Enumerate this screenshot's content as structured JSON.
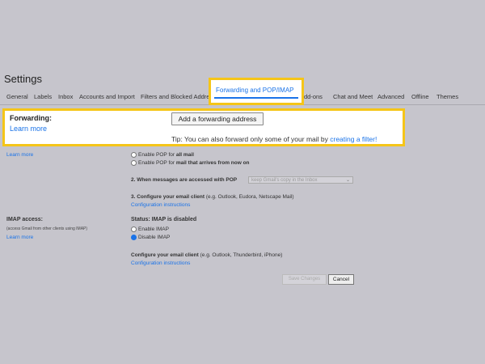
{
  "page_title": "Settings",
  "tabs": [
    {
      "label": "General"
    },
    {
      "label": "Labels"
    },
    {
      "label": "Inbox"
    },
    {
      "label": "Accounts and Import"
    },
    {
      "label": "Filters and Blocked Addre"
    },
    {
      "label": "Forwarding and POP/IMAP"
    },
    {
      "label": "dd-ons"
    },
    {
      "label": "Chat and Meet"
    },
    {
      "label": "Advanced"
    },
    {
      "label": "Offline"
    },
    {
      "label": "Themes"
    }
  ],
  "forwarding": {
    "label": "Forwarding:",
    "learn_more": "Learn more",
    "add_button": "Add a forwarding address",
    "tip_prefix": "Tip: You can also forward only some of your mail by ",
    "tip_link": "creating a filter!"
  },
  "pop": {
    "learn_more": "Learn more",
    "option_all": "Enable POP for",
    "option_all_bold": "all mail",
    "option_now": "Enable POP for",
    "option_now_bold": "mail that arrives from now on",
    "q2_label": "2. When messages are accessed with POP",
    "q2_select": "keep Gmail's copy in the Inbox",
    "q3_label": "3. Configure your email client",
    "q3_hint": "(e.g. Outlook, Eudora, Netscape Mail)",
    "config_link": "Configuration instructions"
  },
  "imap": {
    "label": "IMAP access:",
    "sub": "(access Gmail from other clients using IMAP)",
    "learn_more": "Learn more",
    "status": "Status: IMAP is disabled",
    "enable": "Enable IMAP",
    "disable": "Disable IMAP",
    "configure": "Configure your email client",
    "configure_hint": "(e.g. Outlook, Thunderbird, iPhone)",
    "config_link": "Configuration instructions"
  },
  "footer": {
    "save": "Save Changes",
    "cancel": "Cancel"
  },
  "colors": {
    "highlight": "#f5c518",
    "link": "#1a73e8",
    "overlay": "#c6c5cc"
  }
}
